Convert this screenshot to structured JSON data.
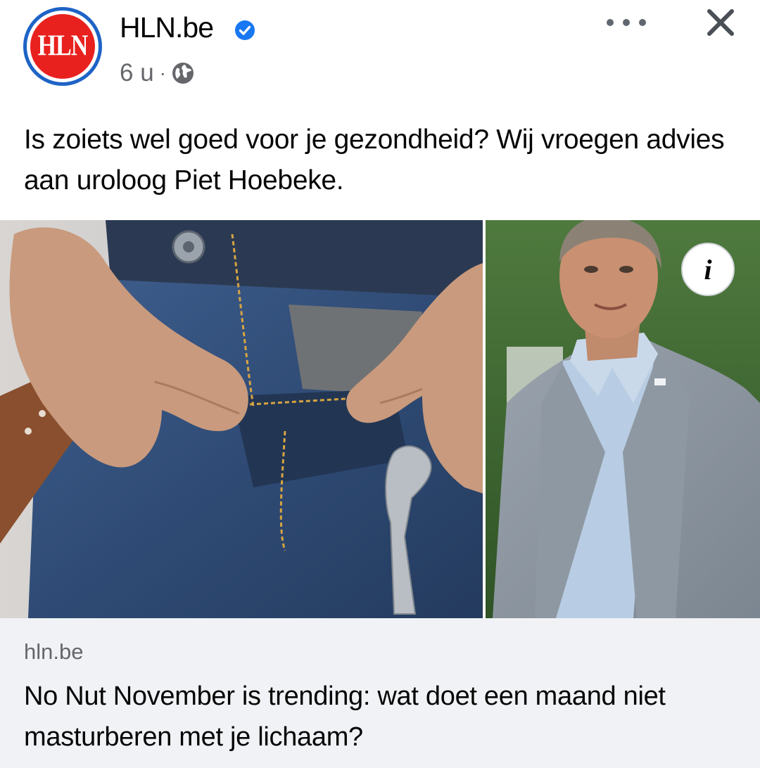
{
  "post": {
    "author": "HLN.be",
    "avatar_label": "HLN",
    "time": "6 u",
    "separator": "·",
    "privacy_icon": "globe-icon",
    "verified_icon": "verified-badge-icon",
    "caption": "Is zoiets wel goed voor je gezondheid? Wij vroegen advies aan uroloog Piet Hoebeke."
  },
  "actions": {
    "more_icon": "more-dots-icon",
    "close_icon": "close-icon",
    "info_label": "i"
  },
  "link": {
    "domain": "hln.be",
    "title": "No Nut November is trending: wat doet een maand niet masturberen met je lichaam?"
  },
  "colors": {
    "brand_red": "#e8211e",
    "brand_blue": "#1e63c6",
    "verified_blue": "#1877f2",
    "meta_gray": "#65676b",
    "link_bg": "#f0f2f5"
  }
}
